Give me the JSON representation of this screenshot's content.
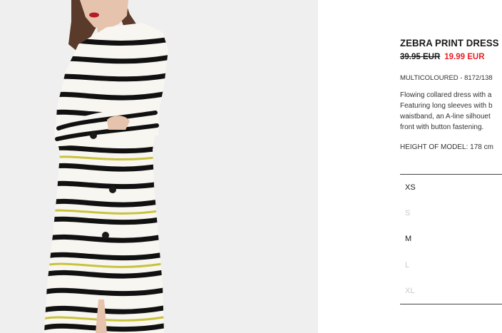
{
  "product": {
    "title": "ZEBRA PRINT DRESS",
    "price_original": "39.95 EUR",
    "price_sale": "19.99 EUR",
    "color_ref": "MULTICOLOURED - 8172/138",
    "description_lines": [
      "Flowing collared dress with a",
      "Featuring long sleeves with b",
      "waistband, an A-line silhouet",
      "front with button fastening."
    ],
    "model_height": "HEIGHT OF MODEL: 178 cm"
  },
  "sizes": [
    {
      "label": "XS",
      "available": true
    },
    {
      "label": "S",
      "available": false
    },
    {
      "label": "M",
      "available": true
    },
    {
      "label": "L",
      "available": false
    },
    {
      "label": "XL",
      "available": false
    }
  ],
  "colors": {
    "sale_price": "#e8202a",
    "image_background": "#efefef"
  }
}
